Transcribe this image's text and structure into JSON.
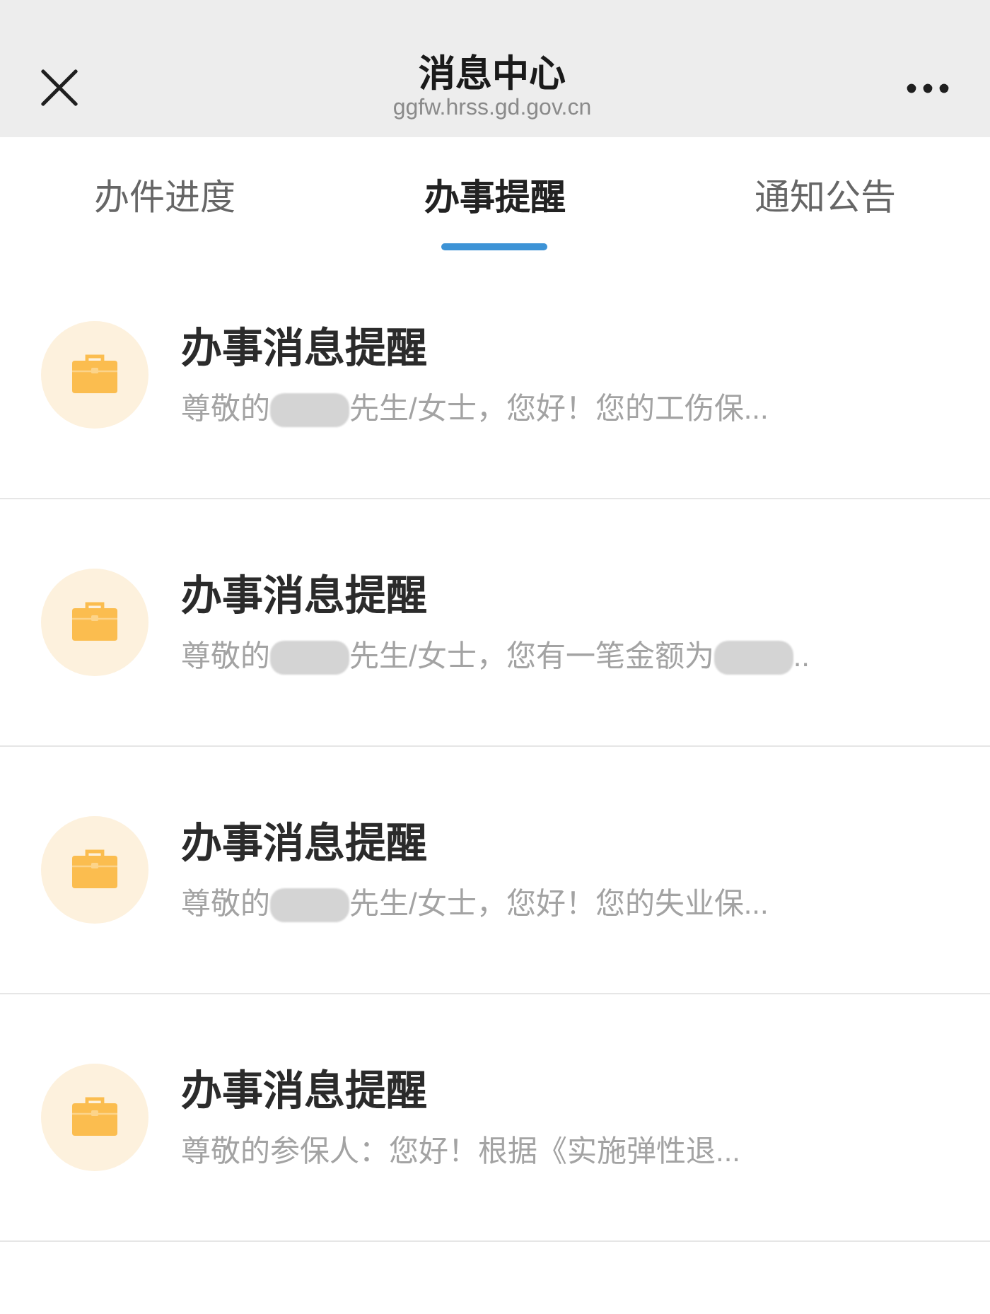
{
  "header": {
    "title": "消息中心",
    "subtitle": "ggfw.hrss.gd.gov.cn"
  },
  "tabs": [
    {
      "label": "办件进度",
      "selected": false
    },
    {
      "label": "办事提醒",
      "selected": true
    },
    {
      "label": "通知公告",
      "selected": false
    }
  ],
  "messages": [
    {
      "title": "办事消息提醒",
      "preview": [
        {
          "kind": "text",
          "text": "尊敬的"
        },
        {
          "kind": "redacted"
        },
        {
          "kind": "text",
          "text": "先生/女士，您好！您的工伤保..."
        }
      ]
    },
    {
      "title": "办事消息提醒",
      "preview": [
        {
          "kind": "text",
          "text": "尊敬的"
        },
        {
          "kind": "redacted"
        },
        {
          "kind": "text",
          "text": "先生/女士，您有一笔金额为"
        },
        {
          "kind": "redacted"
        },
        {
          "kind": "text",
          "text": ".."
        }
      ]
    },
    {
      "title": "办事消息提醒",
      "preview": [
        {
          "kind": "text",
          "text": "尊敬的"
        },
        {
          "kind": "redacted"
        },
        {
          "kind": "text",
          "text": "先生/女士，您好！您的失业保..."
        }
      ]
    },
    {
      "title": "办事消息提醒",
      "preview": [
        {
          "kind": "text",
          "text": "尊敬的参保人：您好！根据《实施弹性退..."
        }
      ]
    }
  ]
}
